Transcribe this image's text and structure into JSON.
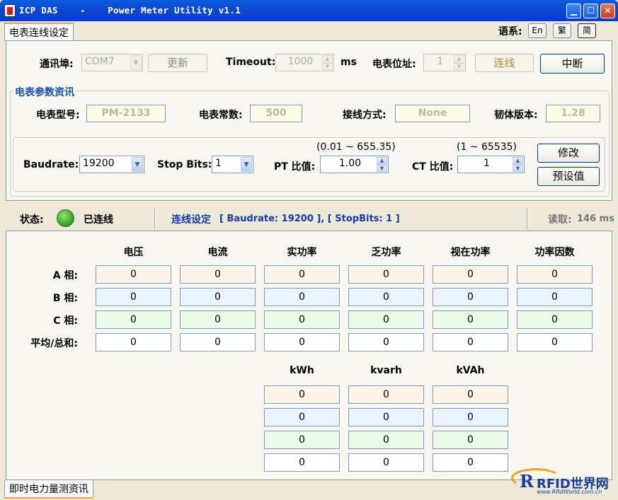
{
  "window": {
    "title": "ICP DAS    -    Power Meter Utility v1.1",
    "controls": [
      "minimize-icon",
      "maximize-icon",
      "close-icon"
    ]
  },
  "top_tab": {
    "label": "电表连线设定"
  },
  "language": {
    "label": "语系:",
    "options": [
      "En",
      "繁",
      "简"
    ],
    "selected": "简"
  },
  "connection": {
    "port_label": "通讯埠:",
    "port_value": "COM7",
    "refresh_label": "更新",
    "timeout_label": "Timeout:",
    "timeout_value": "1000",
    "timeout_unit": "ms",
    "address_label": "电表位址:",
    "address_value": "1",
    "connect_label": "连线",
    "disconnect_label": "中断"
  },
  "meter_params": {
    "title": "电表参数资讯",
    "model_label": "电表型号:",
    "model_value": "PM-2133",
    "constant_label": "电表常数:",
    "constant_value": "500",
    "wiring_label": "接线方式:",
    "wiring_value": "None",
    "firmware_label": "韧体版本:",
    "firmware_value": "1.28"
  },
  "settings": {
    "baudrate_label": "Baudrate:",
    "baudrate_value": "19200",
    "stopbits_label": "Stop Bits:",
    "stopbits_value": "1",
    "pt_label": "PT 比值:",
    "pt_range": "(0.01 ~ 655.35)",
    "pt_value": "1.00",
    "ct_label": "CT 比值:",
    "ct_range": "(1 ~ 65535)",
    "ct_value": "1",
    "modify_label": "修改",
    "default_label": "预设值"
  },
  "status": {
    "label": "状态:",
    "indicator_color": "#3fae2a",
    "state_text": "已连线",
    "conn_title": "连线设定",
    "conn_detail": "[ Baudrate: 19200 ], [ StopBits: 1 ]",
    "read_label": "读取:",
    "read_value": "146 ms"
  },
  "measurements": {
    "headers": [
      "电压",
      "电流",
      "实功率",
      "乏功率",
      "视在功率",
      "功率因数"
    ],
    "rows": [
      {
        "label": "A 相:",
        "values": [
          "0",
          "0",
          "0",
          "0",
          "0",
          "0"
        ]
      },
      {
        "label": "B 相:",
        "values": [
          "0",
          "0",
          "0",
          "0",
          "0",
          "0"
        ]
      },
      {
        "label": "C 相:",
        "values": [
          "0",
          "0",
          "0",
          "0",
          "0",
          "0"
        ]
      },
      {
        "label": "平均/总和:",
        "values": [
          "0",
          "0",
          "0",
          "0",
          "0",
          "0"
        ]
      }
    ],
    "energy_headers": [
      "kWh",
      "kvarh",
      "kVAh"
    ],
    "energy_rows": [
      [
        "0",
        "0",
        "0"
      ],
      [
        "0",
        "0",
        "0"
      ],
      [
        "0",
        "0",
        "0"
      ],
      [
        "0",
        "0",
        "0"
      ]
    ]
  },
  "bottom_tab": {
    "label": "即时电力量测资讯"
  },
  "watermark": {
    "brand": "RFID世界网",
    "url": "www.RfidWorld.com.cn"
  },
  "colors": {
    "titlebar": "#0b4ad3",
    "row_a": "#fdf3e7",
    "row_b": "#eaf3fc",
    "row_c": "#eafbea",
    "group_title": "#1a4fa8"
  }
}
